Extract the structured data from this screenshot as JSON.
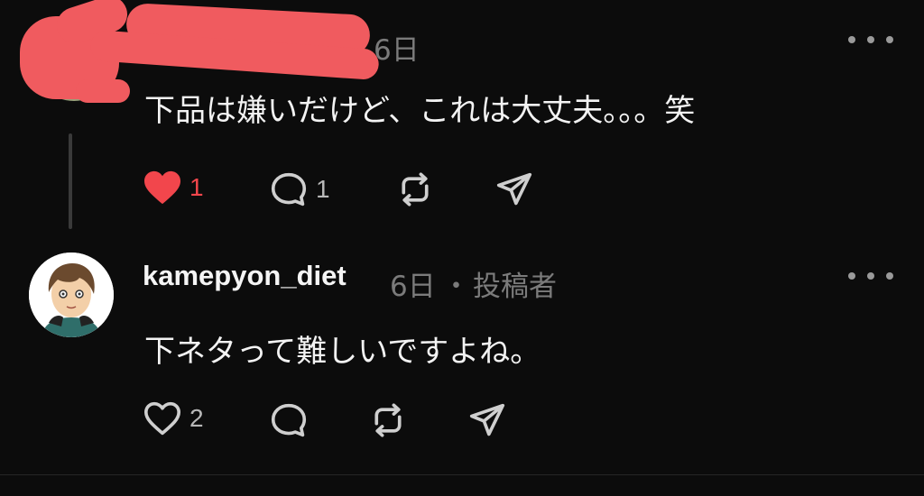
{
  "posts": [
    {
      "username": "",
      "age": "6日",
      "text": "下品は嫌いだけど、これは大丈夫。。。笑",
      "likes": "1",
      "liked": true,
      "replies": "1",
      "reposts": "",
      "icons": [
        "heart-filled-icon",
        "comment-icon",
        "repost-icon",
        "share-icon",
        "more-dots-icon"
      ]
    },
    {
      "username": "kamepyon_diet",
      "age": "6日",
      "separator": "・",
      "role": "投稿者",
      "text": "下ネタって難しいですよね。",
      "likes": "2",
      "liked": false,
      "replies": "",
      "icons": [
        "heart-outline-icon",
        "comment-icon",
        "repost-icon",
        "share-icon",
        "more-dots-icon"
      ]
    }
  ],
  "colors": {
    "background": "#0c0c0c",
    "like_red": "#f2464c",
    "redaction": "#f05b5f",
    "muted": "#7b7b7b"
  }
}
